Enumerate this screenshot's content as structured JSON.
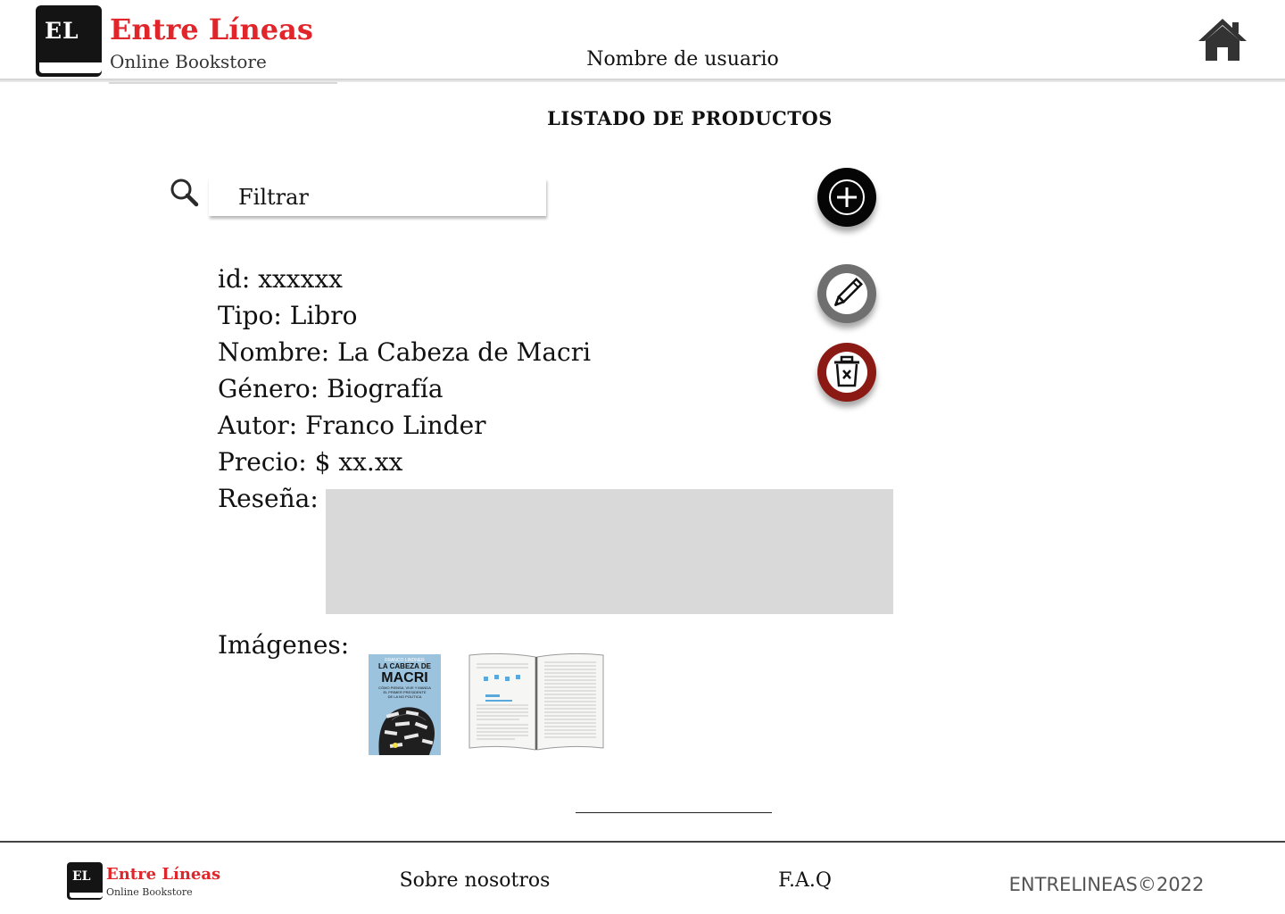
{
  "header": {
    "logo_initials": "EL",
    "logo_name": "Entre Líneas",
    "logo_subtitle": "Online Bookstore",
    "username": "Nombre de usuario",
    "home_icon": "home-icon"
  },
  "main": {
    "title": "LISTADO DE PRODUCTOS",
    "search": {
      "placeholder": "Filtrar",
      "icon": "search-icon"
    },
    "actions": {
      "add_icon": "plus-circle-icon",
      "edit_icon": "pencil-icon",
      "delete_icon": "trash-icon"
    },
    "product": {
      "id": "id: xxxxxx",
      "type": "Tipo: Libro",
      "name": "Nombre: La Cabeza de Macri",
      "genre": "Género: Biografía",
      "author": "Autor: Franco Linder",
      "price": "Precio: $ xx.xx",
      "review_label": "Reseña:",
      "review_text": "",
      "images_label": "Imágenes:",
      "cover": {
        "author_line": "FRANCO LINDNER",
        "title_line1": "LA CABEZA DE",
        "title_line2": "MACRI",
        "tagline_line1": "CÓMO PIENSA, VIVE Y MANDA",
        "tagline_line2": "EL PRIMER PRESIDENTE",
        "tagline_line3": "DE LA NO POLÍTICA"
      }
    }
  },
  "footer": {
    "logo_initials": "EL",
    "logo_name": "Entre Líneas",
    "logo_subtitle": "Online Bookstore",
    "about": "Sobre nosotros",
    "faq": "F.A.Q",
    "copyright": "ENTRELINEAS©2022"
  },
  "colors": {
    "brand_red": "#e0262b",
    "delete_red": "#8b1a14",
    "edit_gray": "#6f6f6f",
    "review_gray": "#d9d9d9",
    "cover_blue": "#9cc3de"
  }
}
